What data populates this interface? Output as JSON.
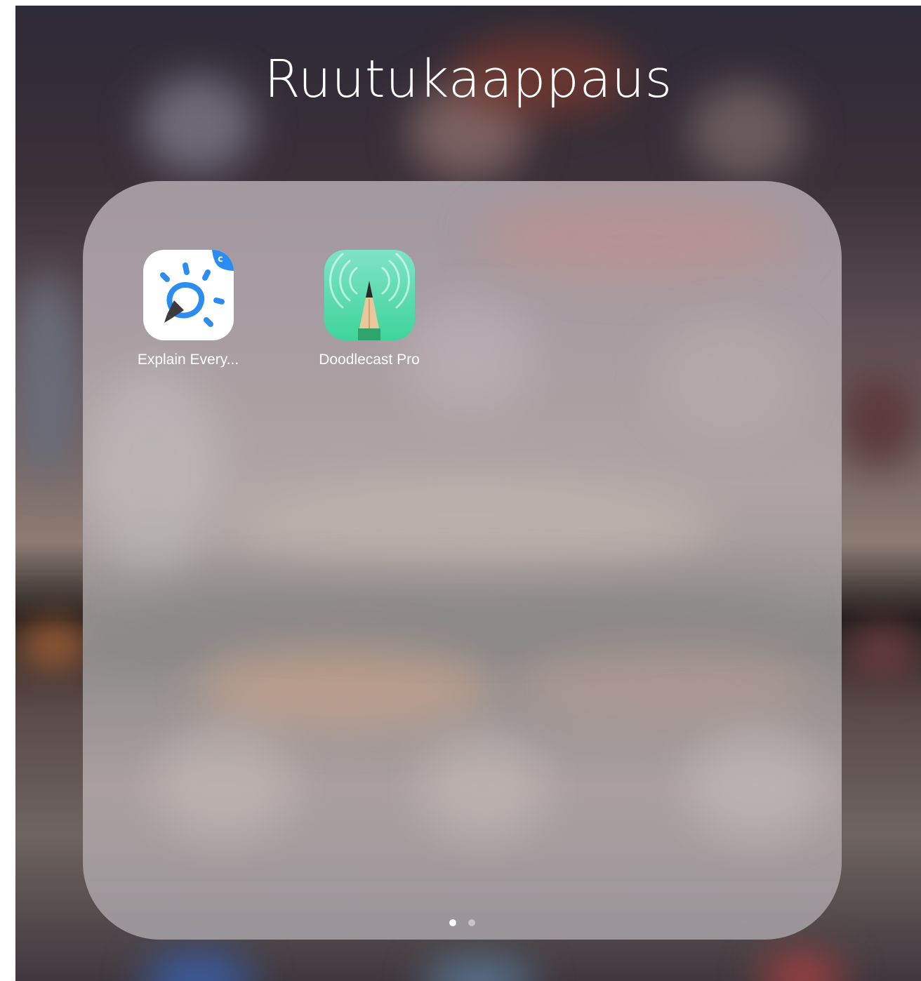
{
  "folder": {
    "title": "Ruutukaappaus",
    "apps": [
      {
        "label": "Explain Every...",
        "icon": "explain-everything-icon",
        "accent": "#2d8cf0"
      },
      {
        "label": "Doodlecast Pro",
        "icon": "doodlecast-pencil-icon",
        "accent": "#3fd49a"
      }
    ],
    "pages": {
      "total": 2,
      "current": 1
    }
  },
  "colors": {
    "dot_active": "#ffffff",
    "dot_inactive": "rgba(255,255,255,0.45)"
  }
}
